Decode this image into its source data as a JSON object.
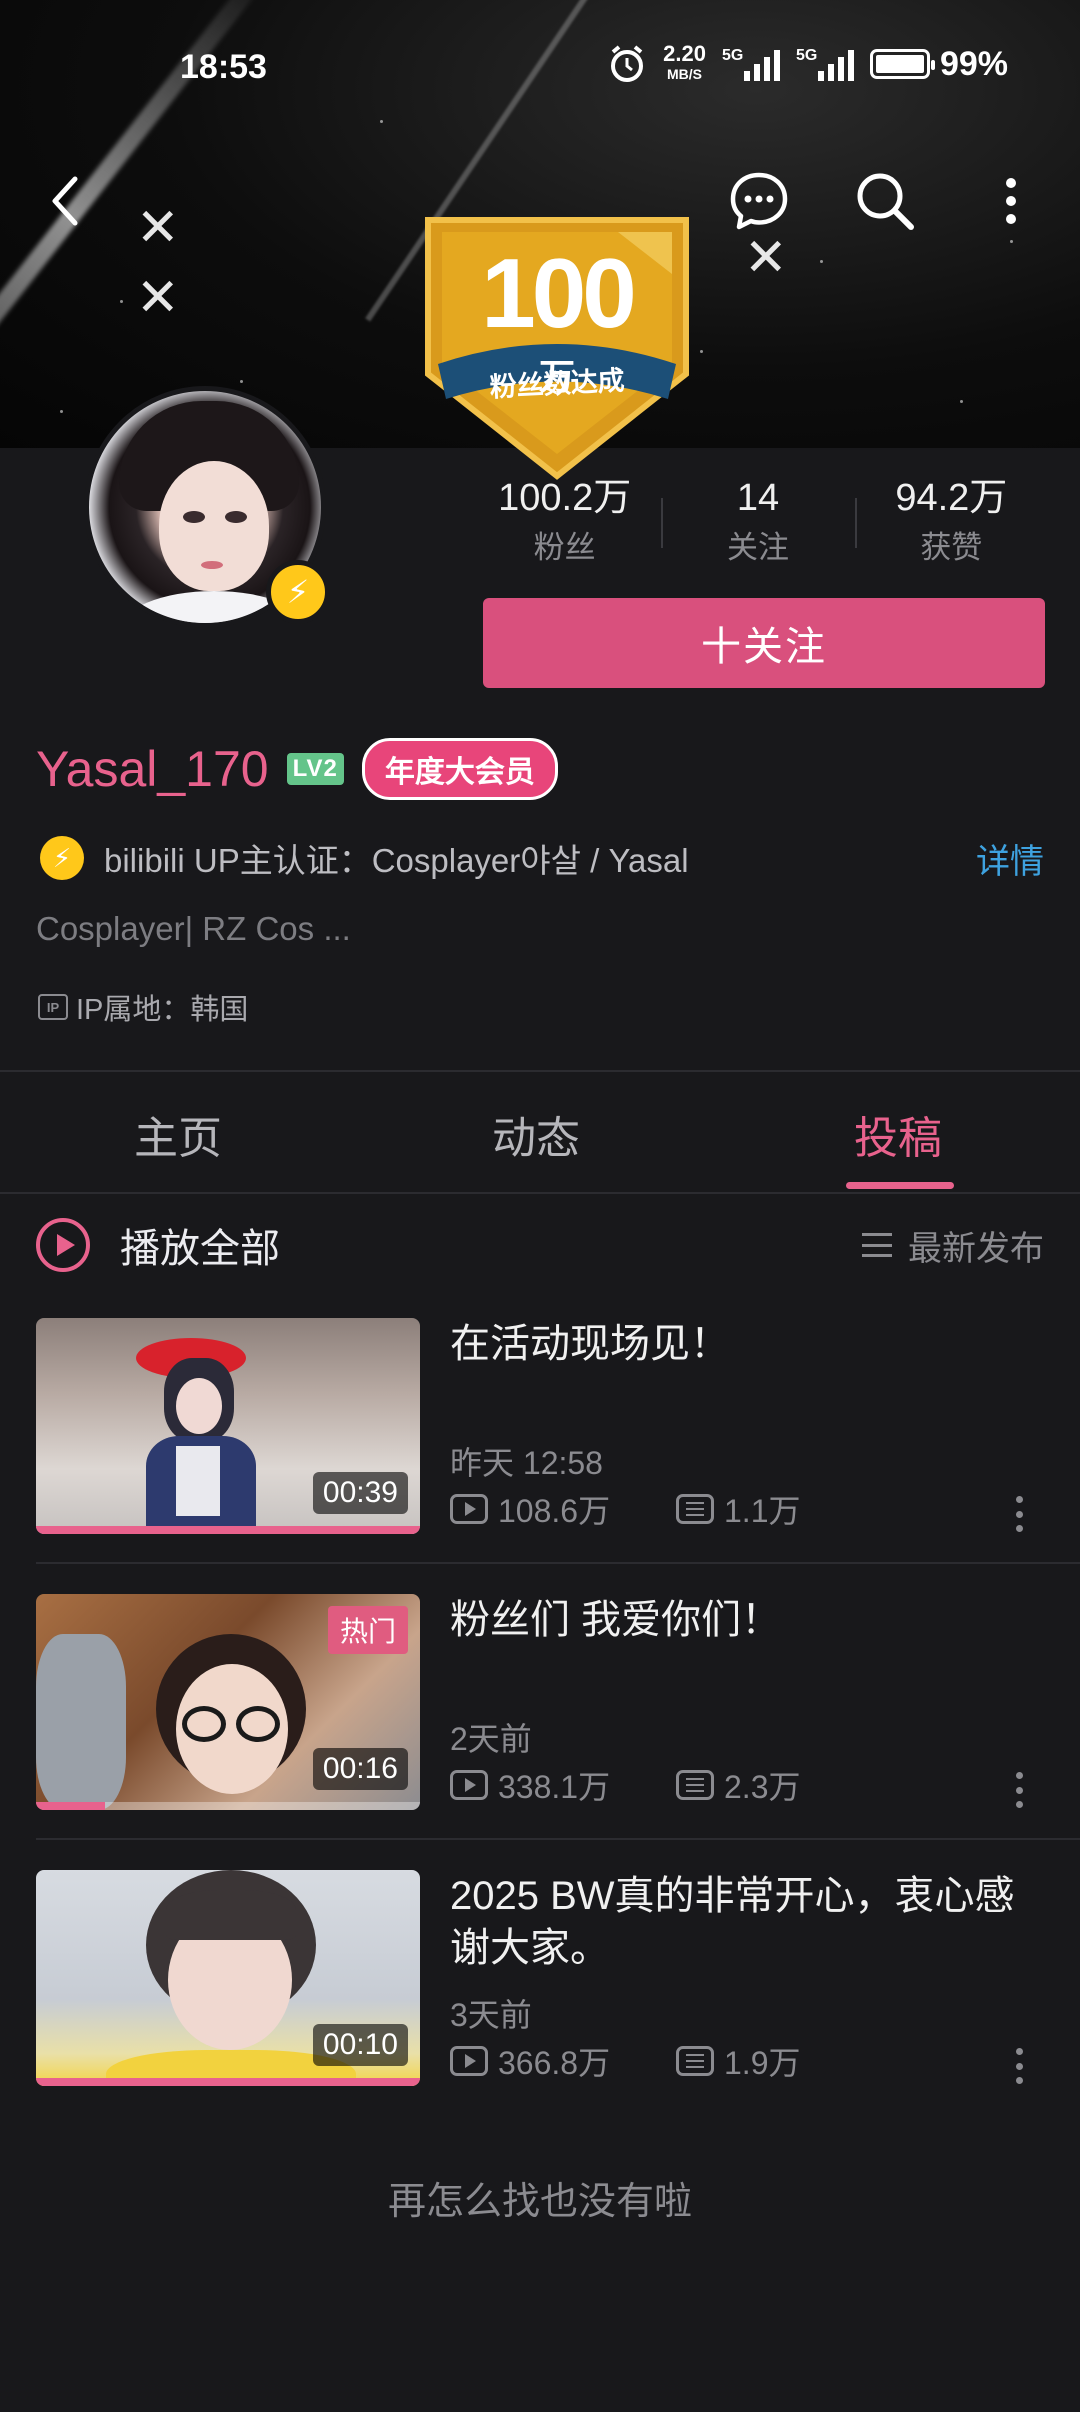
{
  "status_bar": {
    "time": "18:53",
    "net_speed_value": "2.20",
    "net_speed_unit": "MB/S",
    "signal1_label": "5G",
    "signal2_label": "5G",
    "battery": "99%"
  },
  "banner": {
    "badge_number": "100",
    "badge_unit": "万",
    "badge_text": "粉丝数达成"
  },
  "profile": {
    "username": "Yasal_170",
    "level": "LV2",
    "vip_label": "年度大会员",
    "stats": [
      {
        "value": "100.2万",
        "label": "粉丝"
      },
      {
        "value": "14",
        "label": "关注"
      },
      {
        "value": "94.2万",
        "label": "获赞"
      }
    ],
    "follow_button": "十关注",
    "certification": "bilibili UP主认证：Cosplayer야살 / Yasal",
    "certification_detail": "详情",
    "bio": "Cosplayer| RZ Cos ...",
    "ip_icon": "IP",
    "ip_location": "IP属地：韩国"
  },
  "tabs": [
    {
      "label": "主页",
      "active": false
    },
    {
      "label": "动态",
      "active": false
    },
    {
      "label": "投稿",
      "active": true
    }
  ],
  "play_all": {
    "label": "播放全部",
    "sort_label": "最新发布"
  },
  "videos": [
    {
      "title": "在活动现场见！",
      "date": "昨天 12:58",
      "views": "108.6万",
      "danmaku": "1.1万",
      "duration": "00:39",
      "progress": 1.0
    },
    {
      "title": "粉丝们 我爱你们！",
      "date": "2天前",
      "views": "338.1万",
      "danmaku": "2.3万",
      "duration": "00:16",
      "hot_tag": "热门",
      "progress": 0.18
    },
    {
      "title": "2025 BW真的非常开心，衷心感谢大家。",
      "date": "3天前",
      "views": "366.8万",
      "danmaku": "1.9万",
      "duration": "00:10",
      "progress": 1.0
    }
  ],
  "end_message": "再怎么找也没有啦",
  "colors": {
    "accent": "#e8628d",
    "follow_button": "#d9507d",
    "background": "#18181b",
    "link": "#3ea2e0",
    "verify": "#ffc81a"
  }
}
